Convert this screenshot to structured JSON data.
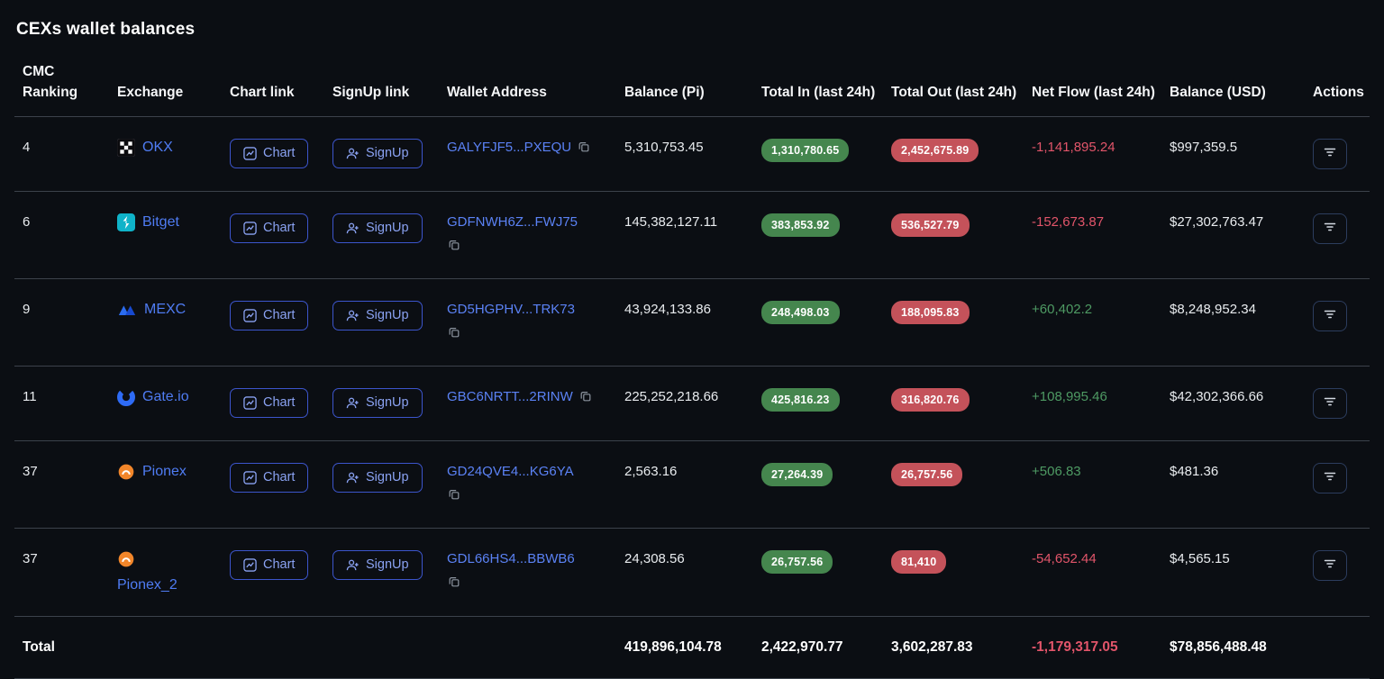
{
  "page": {
    "title": "CEXs wallet balances"
  },
  "colors": {
    "background": "#0b0e13",
    "link_blue": "#4f7cf3",
    "button_border": "#3c55cc",
    "badge_green": "#45864e",
    "badge_red": "#c4525a",
    "netflow_positive": "#4e9a63",
    "netflow_negative": "#e2556a"
  },
  "icons": {
    "chart_button": "chart-icon",
    "signup_button": "user-plus-icon",
    "wallet_copy": "copy-icon",
    "actions": "filter-icon"
  },
  "table": {
    "headers": [
      "CMC Ranking",
      "Exchange",
      "Chart link",
      "SignUp link",
      "Wallet Address",
      "Balance (Pi)",
      "Total In (last 24h)",
      "Total Out (last 24h)",
      "Net Flow (last 24h)",
      "Balance (USD)",
      "Actions"
    ],
    "labels": {
      "chart": "Chart",
      "signup": "SignUp"
    },
    "rows": [
      {
        "ranking": "4",
        "exchange": "OKX",
        "logo_icon": "okx-logo-icon",
        "wallet": "GALYFJF5...PXEQU",
        "balance_pi": "5,310,753.45",
        "total_in": "1,310,780.65",
        "total_out": "2,452,675.89",
        "net_flow": "-1,141,895.24",
        "net_flow_dir": "neg",
        "balance_usd": "$997,359.5"
      },
      {
        "ranking": "6",
        "exchange": "Bitget",
        "logo_icon": "bitget-logo-icon",
        "wallet": "GDFNWH6Z...FWJ75",
        "balance_pi": "145,382,127.11",
        "total_in": "383,853.92",
        "total_out": "536,527.79",
        "net_flow": "-152,673.87",
        "net_flow_dir": "neg",
        "balance_usd": "$27,302,763.47"
      },
      {
        "ranking": "9",
        "exchange": "MEXC",
        "logo_icon": "mexc-logo-icon",
        "wallet": "GD5HGPHV...TRK73",
        "balance_pi": "43,924,133.86",
        "total_in": "248,498.03",
        "total_out": "188,095.83",
        "net_flow": "+60,402.2",
        "net_flow_dir": "pos",
        "balance_usd": "$8,248,952.34"
      },
      {
        "ranking": "11",
        "exchange": "Gate.io",
        "logo_icon": "gateio-logo-icon",
        "wallet": "GBC6NRTT...2RINW",
        "balance_pi": "225,252,218.66",
        "total_in": "425,816.23",
        "total_out": "316,820.76",
        "net_flow": "+108,995.46",
        "net_flow_dir": "pos",
        "balance_usd": "$42,302,366.66"
      },
      {
        "ranking": "37",
        "exchange": "Pionex",
        "logo_icon": "pionex-logo-icon",
        "wallet": "GD24QVE4...KG6YA",
        "balance_pi": "2,563.16",
        "total_in": "27,264.39",
        "total_out": "26,757.56",
        "net_flow": "+506.83",
        "net_flow_dir": "pos",
        "balance_usd": "$481.36"
      },
      {
        "ranking": "37",
        "exchange": "Pionex_2",
        "logo_icon": "pionex-logo-icon",
        "wallet": "GDL66HS4...BBWB6",
        "balance_pi": "24,308.56",
        "total_in": "26,757.56",
        "total_out": "81,410",
        "net_flow": "-54,652.44",
        "net_flow_dir": "neg",
        "balance_usd": "$4,565.15"
      }
    ],
    "total": {
      "label": "Total",
      "balance_pi": "419,896,104.78",
      "total_in": "2,422,970.77",
      "total_out": "3,602,287.83",
      "net_flow": "-1,179,317.05",
      "net_flow_dir": "neg",
      "balance_usd": "$78,856,488.48"
    }
  }
}
